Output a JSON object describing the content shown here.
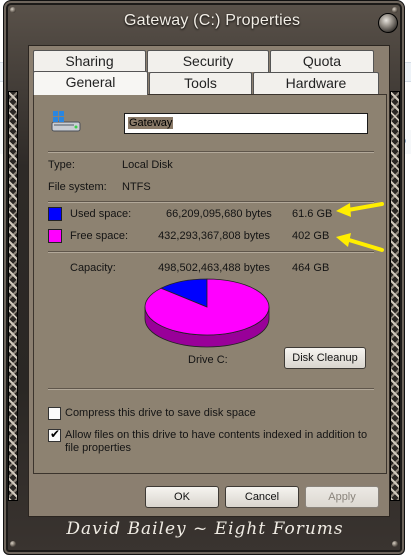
{
  "window": {
    "title": "Gateway (C:) Properties",
    "close_icon": "close-orb-icon"
  },
  "tabs_row1": [
    {
      "label": "Sharing"
    },
    {
      "label": "Security"
    },
    {
      "label": "Quota"
    }
  ],
  "tabs_row2": [
    {
      "label": "General",
      "active": true
    },
    {
      "label": "Tools"
    },
    {
      "label": "Hardware"
    }
  ],
  "general": {
    "drive_icon": "drive-icon",
    "drive_name": "Gateway",
    "type_label": "Type:",
    "type_value": "Local Disk",
    "fs_label": "File system:",
    "fs_value": "NTFS",
    "used": {
      "label": "Used space:",
      "bytes": "66,209,095,680 bytes",
      "size": "61.6 GB",
      "color": "#0000ff"
    },
    "free": {
      "label": "Free space:",
      "bytes": "432,293,367,808 bytes",
      "size": "402 GB",
      "color": "#ff00ff"
    },
    "capacity": {
      "label": "Capacity:",
      "bytes": "498,502,463,488 bytes",
      "size": "464 GB"
    },
    "drive_caption": "Drive C:",
    "cleanup_label": "Disk Cleanup",
    "compress_label": "Compress this drive to save disk space",
    "compress_checked": false,
    "index_label_line1": "Allow files on this drive to have contents indexed in addition to",
    "index_label_line2": "file properties",
    "index_checked": true
  },
  "chart_data": {
    "type": "pie",
    "categories": [
      "Used space",
      "Free space"
    ],
    "values": [
      66209095680,
      432293367808
    ],
    "colors": [
      "#0000ff",
      "#ff00ff"
    ]
  },
  "buttons": {
    "ok": "OK",
    "cancel": "Cancel",
    "apply": "Apply",
    "apply_enabled": false
  },
  "annotations": {
    "arrow_color": "#ffee00"
  },
  "footer": {
    "signature": "David Bailey ~ Eight Forums"
  }
}
